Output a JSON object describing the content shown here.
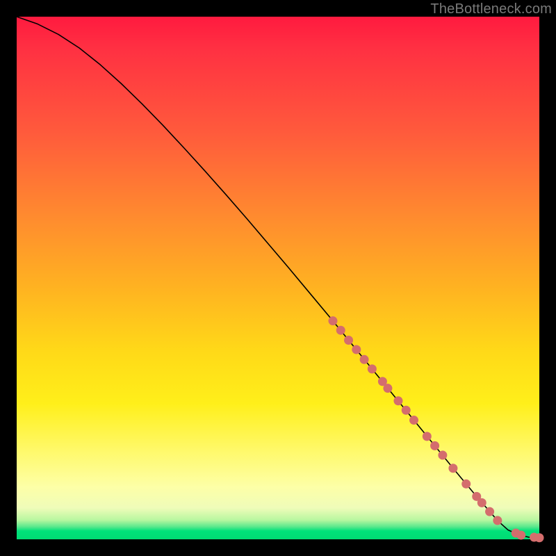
{
  "watermark": "TheBottleneck.com",
  "colors": {
    "curve": "#000000",
    "marker_fill": "#d46d6d",
    "marker_stroke": "#b84f4f"
  },
  "chart_data": {
    "type": "line",
    "title": "",
    "xlabel": "",
    "ylabel": "",
    "xlim": [
      0,
      100
    ],
    "ylim": [
      0,
      100
    ],
    "grid": false,
    "curve": {
      "x": [
        0,
        4,
        8,
        12,
        16,
        20,
        24,
        28,
        32,
        36,
        40,
        44,
        48,
        52,
        56,
        60,
        64,
        68,
        72,
        76,
        80,
        84,
        88,
        92,
        94,
        96,
        98,
        100
      ],
      "y": [
        100,
        98.6,
        96.6,
        94.0,
        90.8,
        87.2,
        83.3,
        79.2,
        74.9,
        70.5,
        66.0,
        61.4,
        56.7,
        52.0,
        47.2,
        42.4,
        37.5,
        32.6,
        27.7,
        22.8,
        17.9,
        13.0,
        8.2,
        3.6,
        1.8,
        0.9,
        0.4,
        0.3
      ]
    },
    "markers": {
      "comment": "approximate positions (in chart x,y) of the highlighted dots on the curve",
      "points": [
        {
          "x": 60.5,
          "y": 41.8
        },
        {
          "x": 62.0,
          "y": 40.0
        },
        {
          "x": 63.5,
          "y": 38.1
        },
        {
          "x": 65.0,
          "y": 36.3
        },
        {
          "x": 66.5,
          "y": 34.4
        },
        {
          "x": 68.0,
          "y": 32.6
        },
        {
          "x": 70.0,
          "y": 30.2
        },
        {
          "x": 71.0,
          "y": 28.9
        },
        {
          "x": 73.0,
          "y": 26.5
        },
        {
          "x": 74.5,
          "y": 24.7
        },
        {
          "x": 76.0,
          "y": 22.8
        },
        {
          "x": 78.5,
          "y": 19.7
        },
        {
          "x": 80.0,
          "y": 17.9
        },
        {
          "x": 81.5,
          "y": 16.1
        },
        {
          "x": 83.5,
          "y": 13.6
        },
        {
          "x": 86.0,
          "y": 10.6
        },
        {
          "x": 88.0,
          "y": 8.2
        },
        {
          "x": 89.0,
          "y": 7.0
        },
        {
          "x": 90.5,
          "y": 5.3
        },
        {
          "x": 92.0,
          "y": 3.6
        },
        {
          "x": 95.5,
          "y": 1.2
        },
        {
          "x": 96.5,
          "y": 0.8
        },
        {
          "x": 99.0,
          "y": 0.4
        },
        {
          "x": 100.0,
          "y": 0.3
        }
      ],
      "radius": 6.5
    }
  }
}
